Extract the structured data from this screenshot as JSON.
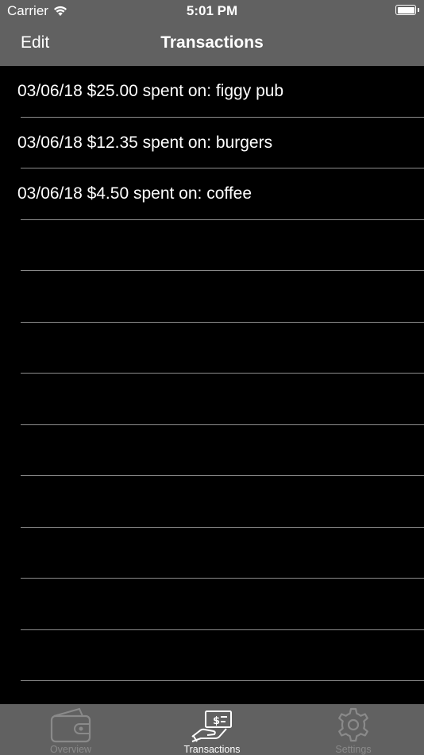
{
  "status_bar": {
    "carrier": "Carrier",
    "time": "5:01 PM"
  },
  "nav": {
    "edit_label": "Edit",
    "title": "Transactions"
  },
  "transactions": [
    "03/06/18 $25.00 spent on: figgy pub",
    "03/06/18 $12.35 spent on: burgers",
    "03/06/18 $4.50 spent on: coffee"
  ],
  "tabs": [
    {
      "label": "Overview",
      "icon": "wallet-icon",
      "active": false
    },
    {
      "label": "Transactions",
      "icon": "cash-hand-icon",
      "active": true
    },
    {
      "label": "Settings",
      "icon": "gear-icon",
      "active": false
    }
  ],
  "colors": {
    "bar_background": "#616161",
    "list_background": "#000000",
    "separator": "#8e8e8e",
    "active_tab": "#ffffff",
    "inactive_tab": "#8a8a8a"
  }
}
